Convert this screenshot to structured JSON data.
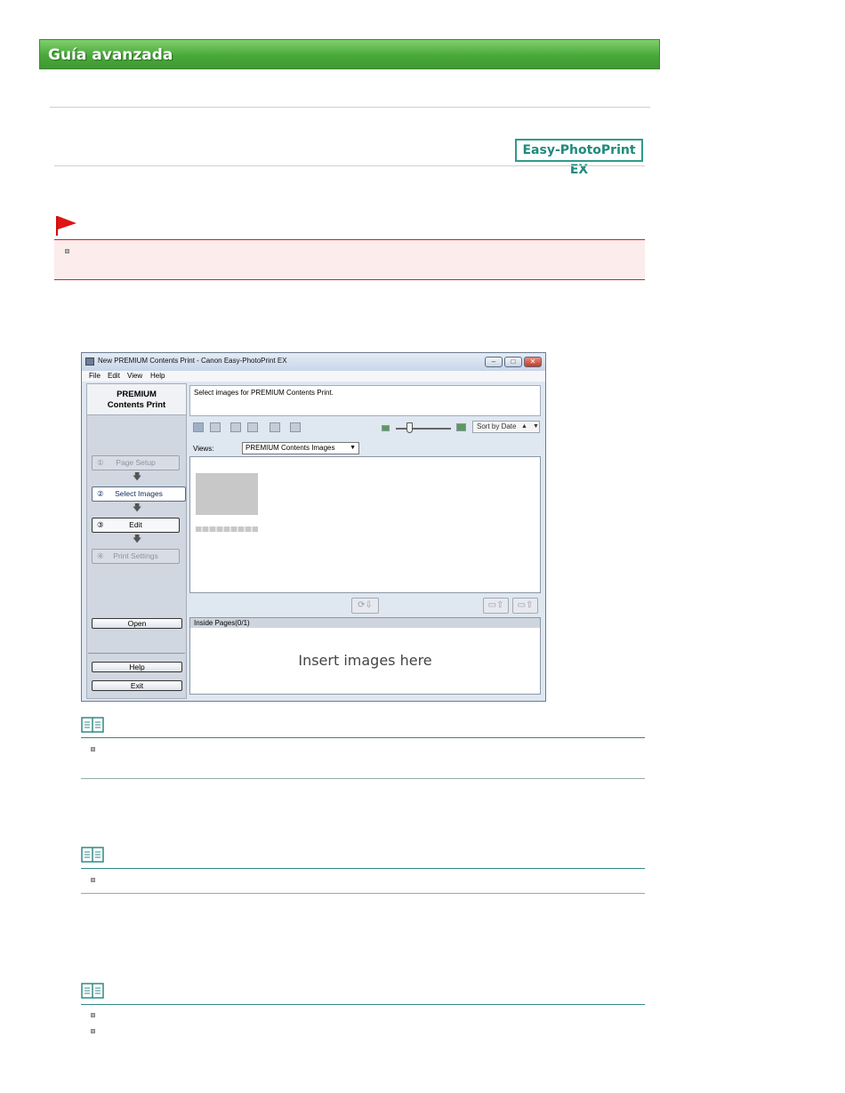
{
  "header": {
    "banner_title": "Guía avanzada",
    "product_logo": "Easy-PhotoPrint EX"
  },
  "icons": {
    "flag": "red-flag-icon",
    "note": "book-note-icon"
  },
  "colors": {
    "banner_green": "#4aa83a",
    "warning_red": "#d42020",
    "note_teal": "#2f8a85"
  },
  "app": {
    "window_title": "New PREMIUM Contents Print - Canon Easy-PhotoPrint EX",
    "menu": [
      "File",
      "Edit",
      "View",
      "Help"
    ],
    "panel_title_line1": "PREMIUM",
    "panel_title_line2": "Contents Print",
    "steps": [
      {
        "num": "①",
        "label": "Page Setup"
      },
      {
        "num": "②",
        "label": "Select Images"
      },
      {
        "num": "③",
        "label": "Edit"
      },
      {
        "num": "④",
        "label": "Print Settings"
      }
    ],
    "open_label": "Open",
    "help_label": "Help",
    "exit_label": "Exit",
    "message": "Select images for PREMIUM Contents Print.",
    "sort_label": "Sort by Date",
    "views_label": "Views:",
    "views_value": "PREMIUM Contents Images",
    "inside_pages_label": "Inside Pages(0/1)",
    "insert_placeholder": "Insert images here"
  }
}
